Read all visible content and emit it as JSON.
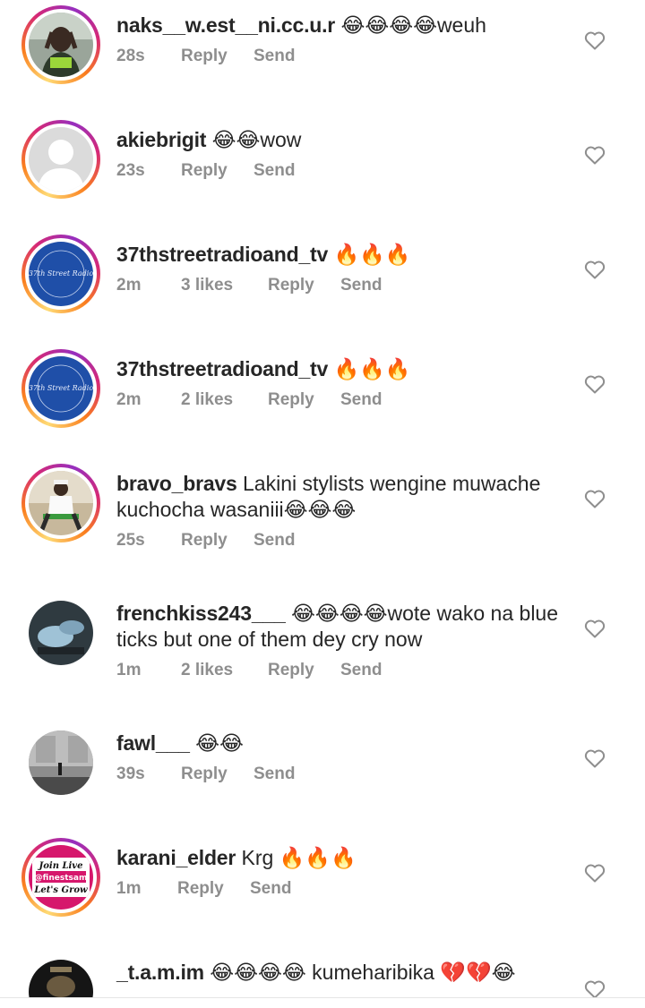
{
  "colors": {
    "text": "#262626",
    "meta": "#8e8e8e",
    "story_ring": [
      "#feda75",
      "#fa7e1e",
      "#d62976",
      "#962fbf"
    ],
    "link_blue": "#1f4fa8",
    "join_live_pink": "#d6176c"
  },
  "icons": {
    "like": "heart-outline-icon"
  },
  "comments": [
    {
      "username": "naks__w.est__ni.cc.u.r",
      "text": "😂😂😂😂weuh",
      "time": "28s",
      "likes": "",
      "reply": "Reply",
      "send": "Send"
    },
    {
      "username": "akiebrigit",
      "text": "😂😂wow",
      "time": "23s",
      "likes": "",
      "reply": "Reply",
      "send": "Send"
    },
    {
      "username": "37thstreetradioand_tv",
      "text": "🔥🔥🔥",
      "time": "2m",
      "likes": "3 likes",
      "reply": "Reply",
      "send": "Send"
    },
    {
      "username": "37thstreetradioand_tv",
      "text": "🔥🔥🔥",
      "time": "2m",
      "likes": "2 likes",
      "reply": "Reply",
      "send": "Send"
    },
    {
      "username": "bravo_bravs",
      "text": "Lakini stylists wengine muwache kuchocha wasaniii😂😂😂",
      "time": "25s",
      "likes": "",
      "reply": "Reply",
      "send": "Send"
    },
    {
      "username": "frenchkiss243___",
      "text": "😂😂😂😂wote wako na blue ticks but one of them dey cry now",
      "time": "1m",
      "likes": "2 likes",
      "reply": "Reply",
      "send": "Send"
    },
    {
      "username": "fawl___",
      "text": "😂😂",
      "time": "39s",
      "likes": "",
      "reply": "Reply",
      "send": "Send"
    },
    {
      "username": "karani_elder",
      "text": "Krg 🔥🔥🔥",
      "time": "1m",
      "likes": "",
      "reply": "Reply",
      "send": "Send"
    },
    {
      "username": "_t.a.m.im",
      "text": "😂😂😂😂 kumeharibika 💔💔😂",
      "time": "",
      "likes": "",
      "reply": "",
      "send": ""
    }
  ],
  "logo_37th": "37th Street Radio",
  "join_live": {
    "line1": "Join Live",
    "line2": "@finestsam",
    "line3": "Let's Grow"
  }
}
